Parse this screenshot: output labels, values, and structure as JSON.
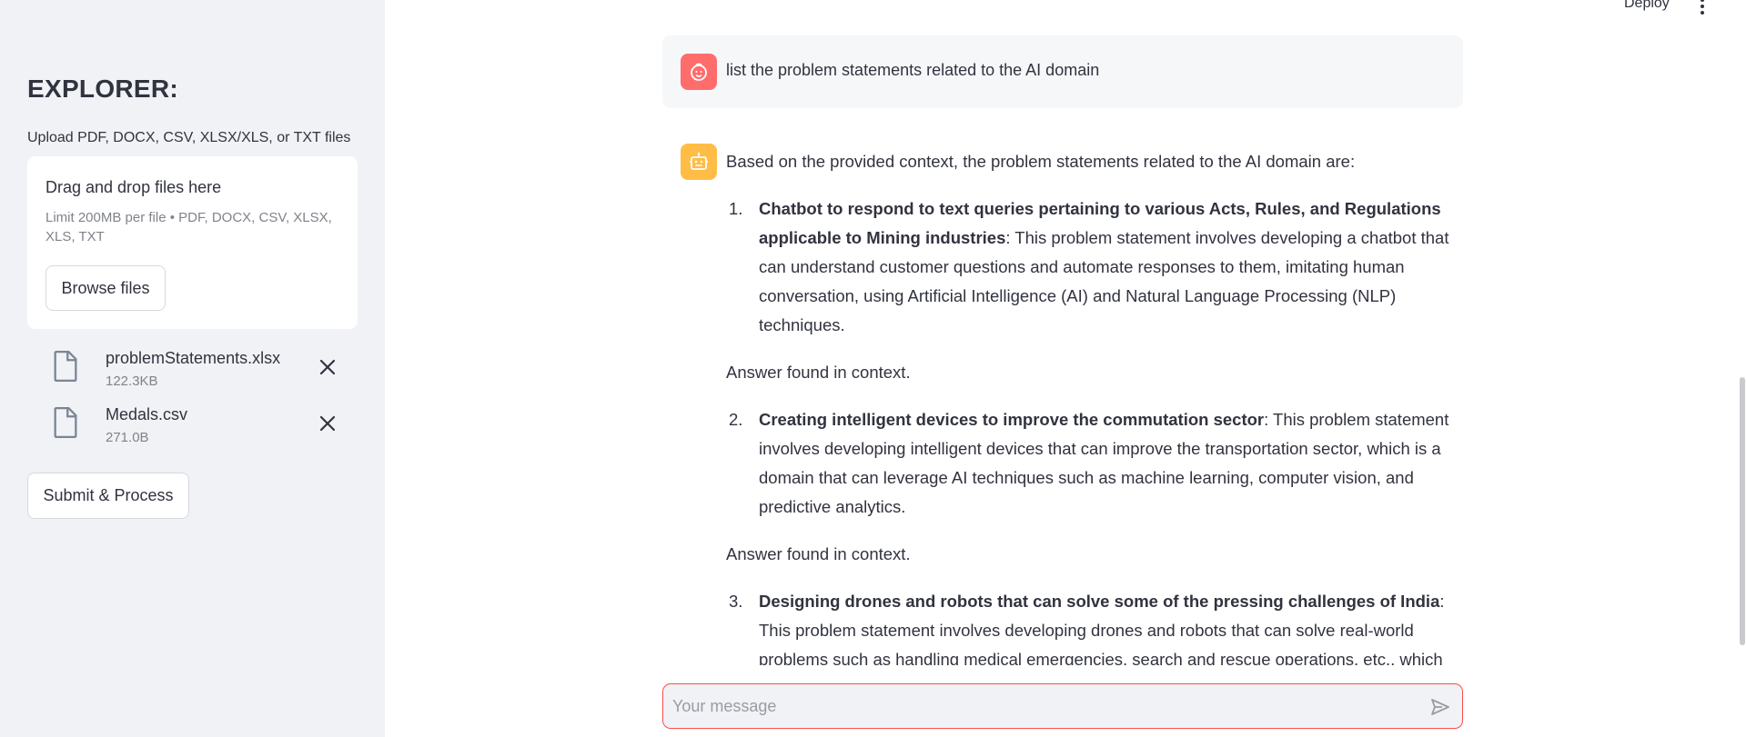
{
  "sidebar": {
    "title": "EXPLORER:",
    "upload_label": "Upload PDF, DOCX, CSV, XLSX/XLS, or TXT files",
    "dropzone": {
      "title": "Drag and drop files here",
      "limit": "Limit 200MB per file • PDF, DOCX, CSV, XLSX, XLS, TXT",
      "browse_label": "Browse files"
    },
    "files": [
      {
        "name": "problemStatements.xlsx",
        "size": "122.3KB",
        "icon": "file-icon"
      },
      {
        "name": "Medals.csv",
        "size": "271.0B",
        "icon": "file-icon"
      }
    ],
    "submit_label": "Submit & Process"
  },
  "header": {
    "deploy_label": "Deploy",
    "menu_icon": "vertical-dots-icon"
  },
  "chat": {
    "user_message": "list the problem statements related to the AI domain",
    "bot_intro": "Based on the provided context, the problem statements related to the AI domain are:",
    "items": [
      {
        "number": "1.",
        "bold": "Chatbot to respond to text queries pertaining to various Acts, Rules, and Regulations applicable to Mining industries",
        "text": ": This problem statement involves developing a chatbot that can understand customer questions and automate responses to them, imitating human conversation, using Artificial Intelligence (AI) and Natural Language Processing (NLP) techniques.",
        "note": "Answer found in context."
      },
      {
        "number": "2.",
        "bold": "Creating intelligent devices to improve the commutation sector",
        "text": ": This problem statement involves developing intelligent devices that can improve the transportation sector, which is a domain that can leverage AI techniques such as machine learning, computer vision, and predictive analytics.",
        "note": "Answer found in context."
      },
      {
        "number": "3.",
        "bold": "Designing drones and robots that can solve some of the pressing challenges of India",
        "text": ": This problem statement involves developing drones and robots that can solve real-world problems such as handling medical emergencies, search and rescue operations, etc., which",
        "note": ""
      }
    ],
    "input_placeholder": "Your message",
    "colors": {
      "user_avatar": "#ff6c6c",
      "bot_avatar": "#ffbd45",
      "input_border": "#ff4b4b"
    }
  }
}
